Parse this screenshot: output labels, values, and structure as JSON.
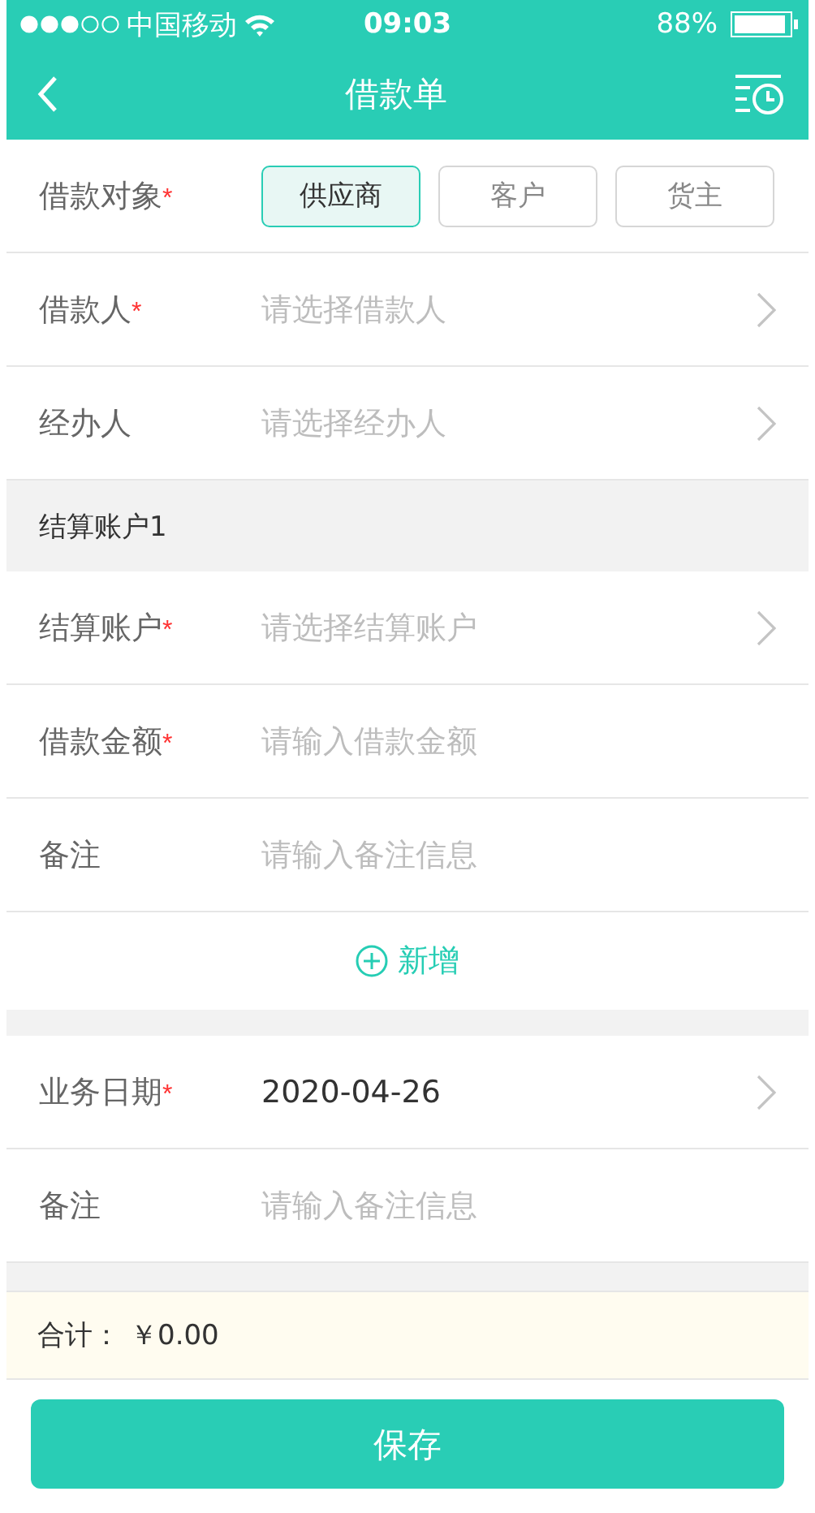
{
  "status_bar": {
    "carrier": "中国移动",
    "time": "09:03",
    "battery": "88%"
  },
  "nav": {
    "title": "借款单"
  },
  "target": {
    "label": "借款对象",
    "required_mark": "*",
    "options": [
      {
        "label": "供应商",
        "selected": true
      },
      {
        "label": "客户",
        "selected": false
      },
      {
        "label": "货主",
        "selected": false
      }
    ]
  },
  "party_fields": [
    {
      "kind": "select",
      "label": "借款人",
      "required_mark": "*",
      "placeholder": "请选择借款人"
    },
    {
      "kind": "select",
      "label": "经办人",
      "placeholder": "请选择经办人"
    }
  ],
  "account_section": {
    "title": "结算账户1",
    "fields": [
      {
        "kind": "select",
        "label": "结算账户",
        "required_mark": "*",
        "placeholder": "请选择结算账户"
      },
      {
        "kind": "input",
        "label": "借款金额",
        "required_mark": "*",
        "placeholder": "请输入借款金额"
      },
      {
        "kind": "input",
        "label": "备注",
        "placeholder": "请输入备注信息"
      }
    ],
    "add_label": "新增"
  },
  "detail_fields": [
    {
      "kind": "select",
      "label": "业务日期",
      "required_mark": "*",
      "value": "2020-04-26"
    },
    {
      "kind": "input",
      "label": "备注",
      "placeholder": "请输入备注信息"
    }
  ],
  "total": {
    "label": "合计：",
    "amount": "￥0.00"
  },
  "save_label": "保存"
}
